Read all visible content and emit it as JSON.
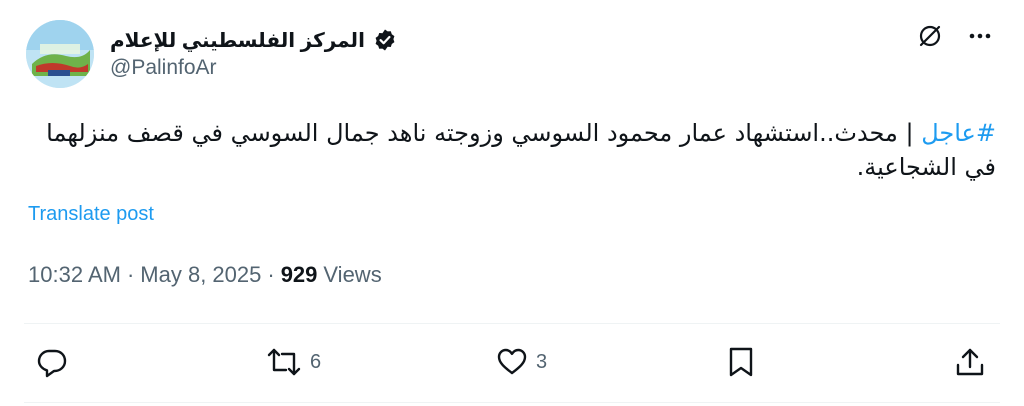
{
  "post": {
    "display_name": "المركز الفلسطيني للإعلام",
    "handle": "@PalinfoAr",
    "hashtag": "#عاجل",
    "body": " | محدث..استشهاد عمار محمود السوسي وزوجته ناهد جمال السوسي في قصف منزلهما في الشجاعية.",
    "translate_label": "Translate post",
    "time": "10:32 AM",
    "separator": "·",
    "date": "May 8, 2025",
    "views_count": "929",
    "views_label": "Views"
  },
  "actions": {
    "reply": {
      "icon": "reply-icon"
    },
    "repost": {
      "icon": "repost-icon",
      "count": "6"
    },
    "like": {
      "icon": "heart-icon",
      "count": "3"
    },
    "bookmark": {
      "icon": "bookmark-icon"
    },
    "share": {
      "icon": "share-icon"
    }
  },
  "top_icons": [
    "grok-icon",
    "more-icon"
  ],
  "colors": {
    "accent": "#1d9bf0",
    "text": "#0f1419",
    "secondary": "#536471",
    "divider": "#eff3f4"
  }
}
